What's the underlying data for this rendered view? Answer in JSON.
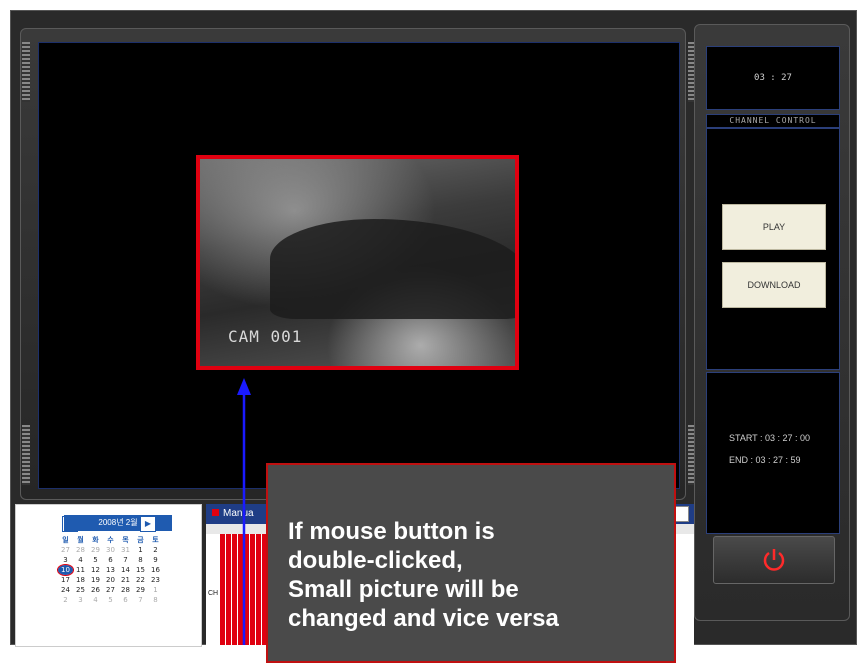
{
  "video": {
    "camera_label": "CAM 001"
  },
  "right_panel": {
    "current_time": "03 : 27",
    "channel_control_label": "CHANNEL CONTROL",
    "play_label": "PLAY",
    "download_label": "DOWNLOAD",
    "start_text": "START : 03 : 27 : 00",
    "end_text": "END   : 03 : 27 : 59"
  },
  "calendar": {
    "header": "2008년 2월",
    "prev": "◀",
    "next": "▶",
    "weekdays": [
      "일",
      "월",
      "화",
      "수",
      "목",
      "금",
      "토"
    ],
    "weeks": [
      [
        "27",
        "28",
        "29",
        "30",
        "31",
        "1",
        "2"
      ],
      [
        "3",
        "4",
        "5",
        "6",
        "7",
        "8",
        "9"
      ],
      [
        "10",
        "11",
        "12",
        "13",
        "14",
        "15",
        "16"
      ],
      [
        "17",
        "18",
        "19",
        "20",
        "21",
        "22",
        "23"
      ],
      [
        "24",
        "25",
        "26",
        "27",
        "28",
        "29",
        "1"
      ],
      [
        "2",
        "3",
        "4",
        "5",
        "6",
        "7",
        "8"
      ]
    ],
    "selected": "10"
  },
  "timeline": {
    "header": "Manua",
    "row_label": "CH"
  },
  "callout": {
    "text": "If mouse button is\ndouble-clicked,\nSmall picture will be\nchanged and vice versa"
  },
  "colors": {
    "highlight_red": "#e00010",
    "arrow_blue": "#1a1aff",
    "accent_blue": "#1f5bb0"
  }
}
